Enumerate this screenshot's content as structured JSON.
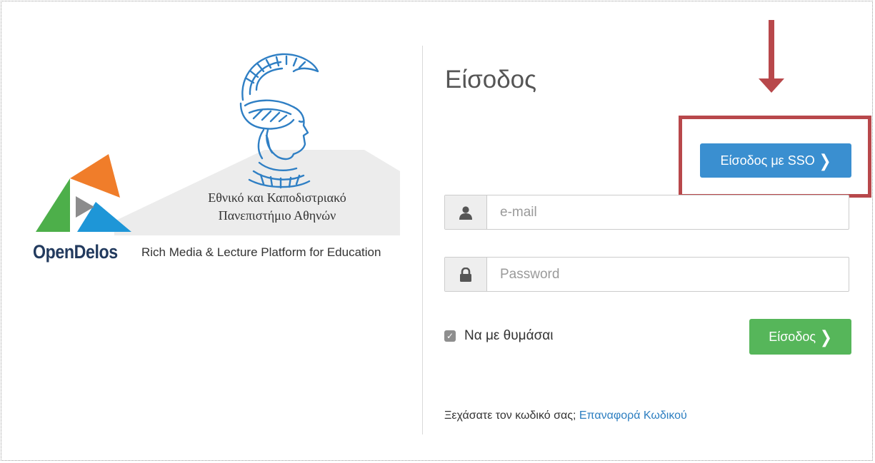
{
  "branding": {
    "university_line1": "Εθνικό και Καποδιστριακό",
    "university_line2": "Πανεπιστήμιο Αθηνών",
    "brand_name": "OpenDelos",
    "brand_tagline": "Rich Media & Lecture Platform for Education",
    "seal_icon": "athena-seal-icon",
    "logo_icon": "opendelos-triangle-logo-icon"
  },
  "login": {
    "title": "Είσοδος",
    "sso_button_label": "Είσοδος με SSO",
    "email_placeholder": "e-mail",
    "email_value": "",
    "password_placeholder": "Password",
    "password_value": "",
    "remember_label": "Να με θυμάσαι",
    "remember_checked": true,
    "submit_label": "Είσοδος",
    "forgot_text": "Ξεχάσατε τον κωδικό σας;",
    "forgot_link": "Επαναφορά Κωδικού",
    "user_icon": "user-icon",
    "lock_icon": "lock-icon",
    "chevron_icon": "chevron-right-icon"
  },
  "annotation": {
    "arrow_icon": "down-arrow-icon",
    "highlight_color": "#b8484b"
  },
  "colors": {
    "sso_button": "#3a8fd0",
    "submit_button": "#56b65a",
    "link": "#2c7ec0",
    "brand_text": "#223a5e"
  }
}
